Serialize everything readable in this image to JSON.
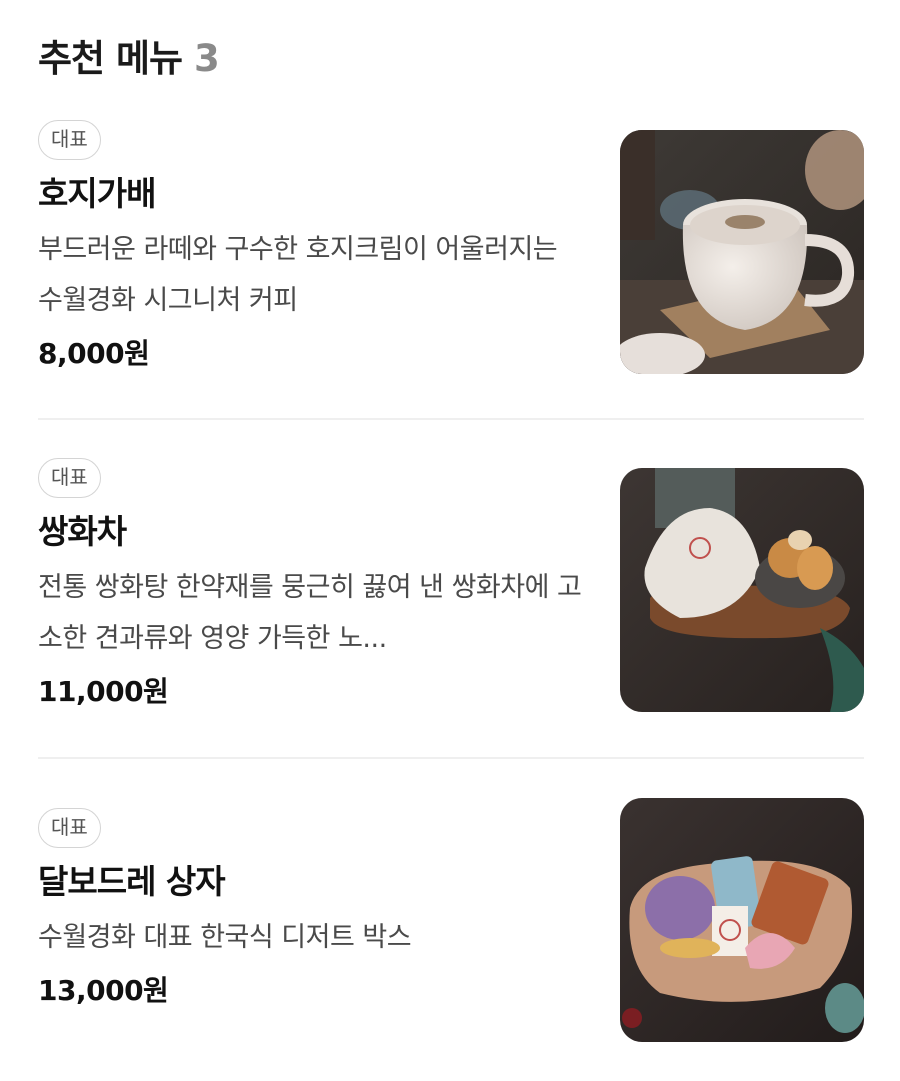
{
  "section": {
    "title": "추천 메뉴",
    "count": "3"
  },
  "items": [
    {
      "badge": "대표",
      "name": "호지가배",
      "description": "부드러운 라떼와 구수한 호지크림이 어울러지는 수월경화 시그니처 커피",
      "price": "8,000원",
      "image_icon": "hojicha-latte-photo"
    },
    {
      "badge": "대표",
      "name": "쌍화차",
      "description": "전통 쌍화탕 한약재를 뭉근히 끓여 낸 쌍화차에 고소한 견과류와 영양 가득한 노...",
      "price": "11,000원",
      "image_icon": "ssanghwa-tea-photo"
    },
    {
      "badge": "대표",
      "name": "달보드레 상자",
      "description": "수월경화 대표 한국식 디저트 박스",
      "price": "13,000원",
      "image_icon": "dessert-box-photo"
    }
  ]
}
